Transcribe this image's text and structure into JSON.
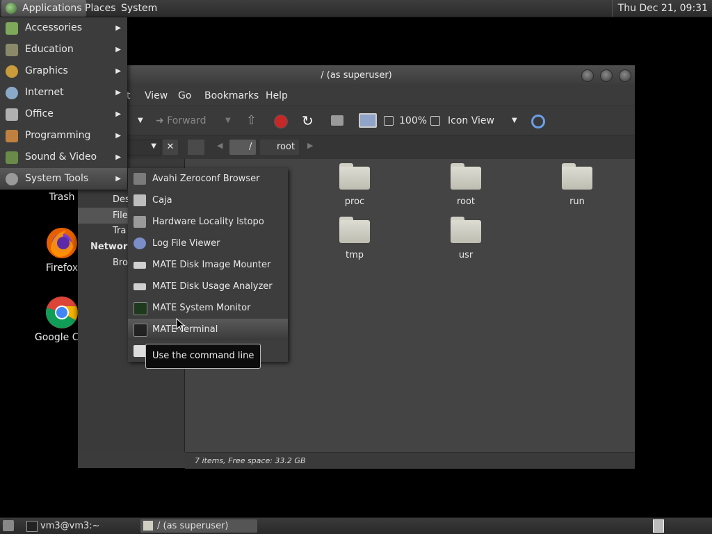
{
  "top_panel": {
    "menus": [
      "Applications",
      "Places",
      "System"
    ],
    "clock": "Thu Dec 21, 09:31"
  },
  "desktop": {
    "icons": [
      {
        "label": "Trash"
      },
      {
        "label": "Firefox"
      },
      {
        "label": "Google Chr"
      }
    ]
  },
  "window": {
    "title": "/ (as superuser)",
    "menubar": [
      "t",
      "View",
      "Go",
      "Bookmarks",
      "Help"
    ],
    "toolbar": {
      "forward_label": "Forward",
      "zoom": "100%",
      "view_mode": "Icon View"
    },
    "location": {
      "crumbs": [
        "/",
        "root"
      ]
    },
    "sidebar": {
      "items": [
        "Des",
        "File",
        "Tra"
      ],
      "section_network": "Network",
      "network_items": [
        "Bro"
      ]
    },
    "files": [
      {
        "name": "proc",
        "type": "folder"
      },
      {
        "name": "root",
        "type": "home-folder"
      },
      {
        "name": "run",
        "type": "folder"
      },
      {
        "name": "tmp",
        "type": "folder"
      },
      {
        "name": "usr",
        "type": "folder"
      }
    ],
    "status": "7 items, Free space: 33.2 GB"
  },
  "app_menu": {
    "items": [
      {
        "label": "Accessories",
        "icon": "accessories-icon"
      },
      {
        "label": "Education",
        "icon": "education-icon"
      },
      {
        "label": "Graphics",
        "icon": "graphics-icon"
      },
      {
        "label": "Internet",
        "icon": "internet-icon"
      },
      {
        "label": "Office",
        "icon": "office-icon"
      },
      {
        "label": "Programming",
        "icon": "programming-icon"
      },
      {
        "label": "Sound & Video",
        "icon": "sound-video-icon"
      },
      {
        "label": "System Tools",
        "icon": "system-tools-icon",
        "selected": true
      }
    ]
  },
  "system_tools_menu": {
    "items": [
      {
        "label": "Avahi Zeroconf Browser"
      },
      {
        "label": "Caja"
      },
      {
        "label": "Hardware Locality lstopo"
      },
      {
        "label": "Log File Viewer"
      },
      {
        "label": "MATE Disk Image Mounter"
      },
      {
        "label": "MATE Disk Usage Analyzer"
      },
      {
        "label": "MATE System Monitor"
      },
      {
        "label": "MATE Terminal",
        "selected": true
      }
    ],
    "tooltip": "Use the command line"
  },
  "bottom_panel": {
    "tasks": [
      "vm3@vm3:~",
      "/ (as superuser)"
    ]
  }
}
